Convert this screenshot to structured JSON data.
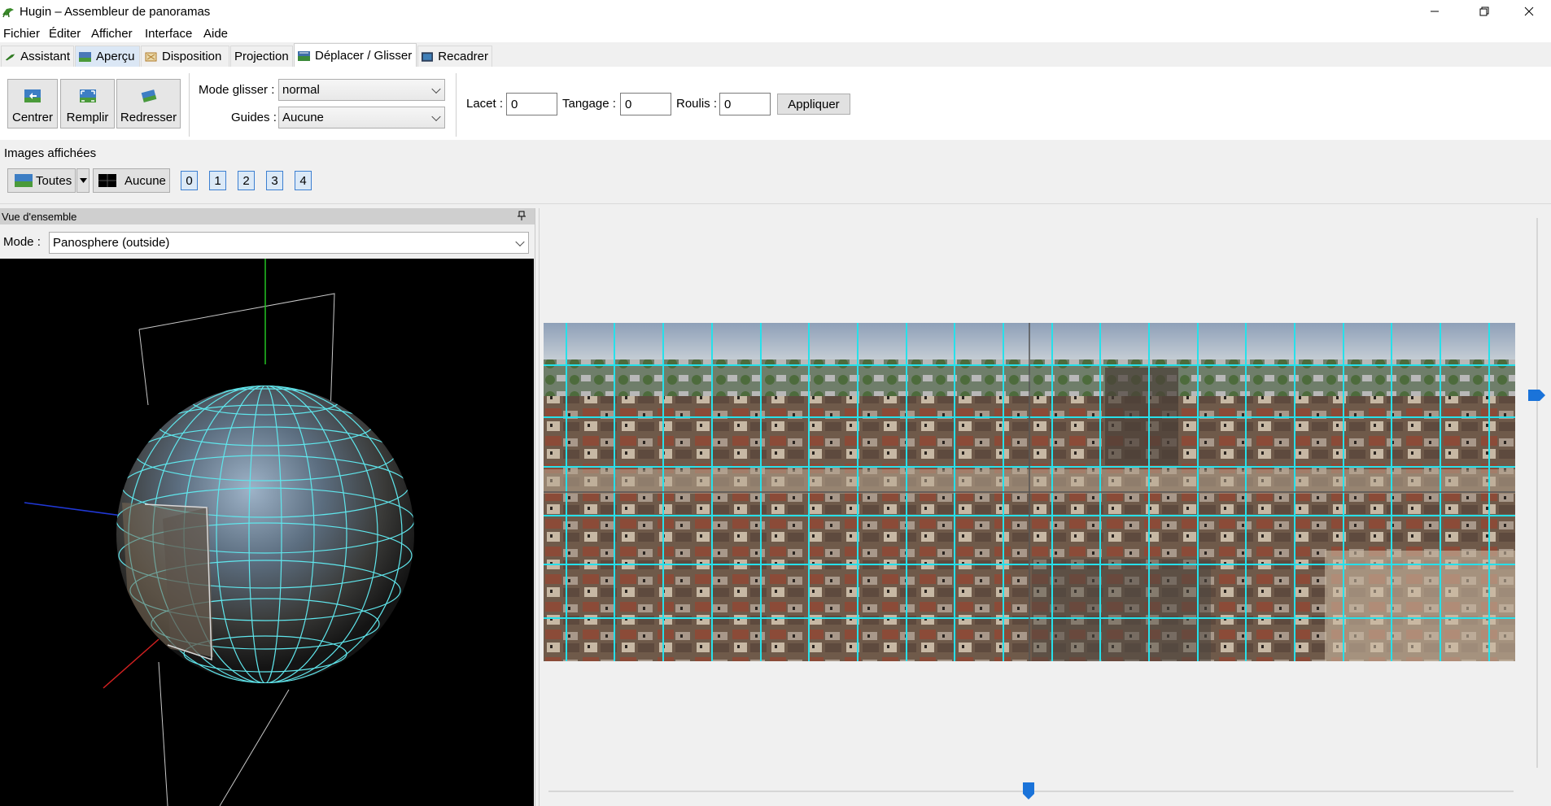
{
  "window": {
    "title": "Hugin – Assembleur de panoramas",
    "app_icon": "hugin-grasshopper-icon",
    "controls": [
      "minimize-icon",
      "restore-icon",
      "close-icon"
    ]
  },
  "menu": [
    "Fichier",
    "Éditer",
    "Afficher",
    "Interface",
    "Aide"
  ],
  "tabs": [
    {
      "label": "Assistant",
      "icon": "wand-icon",
      "active": false
    },
    {
      "label": "Aperçu",
      "icon": "preview-icon",
      "active": false
    },
    {
      "label": "Disposition",
      "icon": "layout-icon",
      "active": false
    },
    {
      "label": "Projection",
      "icon": "",
      "active": false
    },
    {
      "label": "Déplacer / Glisser",
      "icon": "move-drag-icon",
      "active": true
    },
    {
      "label": "Recadrer",
      "icon": "crop-icon",
      "active": false
    }
  ],
  "toolbar": {
    "center_label": "Centrer",
    "fit_label": "Remplir",
    "straighten_label": "Redresser",
    "drag_mode_label": "Mode glisser :",
    "drag_mode_value": "normal",
    "guides_label": "Guides :",
    "guides_value": "Aucune",
    "yaw_label": "Lacet :",
    "yaw_value": "0",
    "pitch_label": "Tangage :",
    "pitch_value": "0",
    "roll_label": "Roulis :",
    "roll_value": "0",
    "apply_label": "Appliquer"
  },
  "images": {
    "section_label": "Images affichées",
    "all_label": "Toutes",
    "none_label": "Aucune",
    "numbers": [
      "0",
      "1",
      "2",
      "3",
      "4"
    ]
  },
  "overview": {
    "header": "Vue d'ensemble",
    "mode_label": "Mode :",
    "mode_value": "Panosphere (outside)"
  },
  "colors": {
    "accent": "#3c7fd1",
    "grid": "#27e0ea",
    "slider": "#1a73d9"
  }
}
